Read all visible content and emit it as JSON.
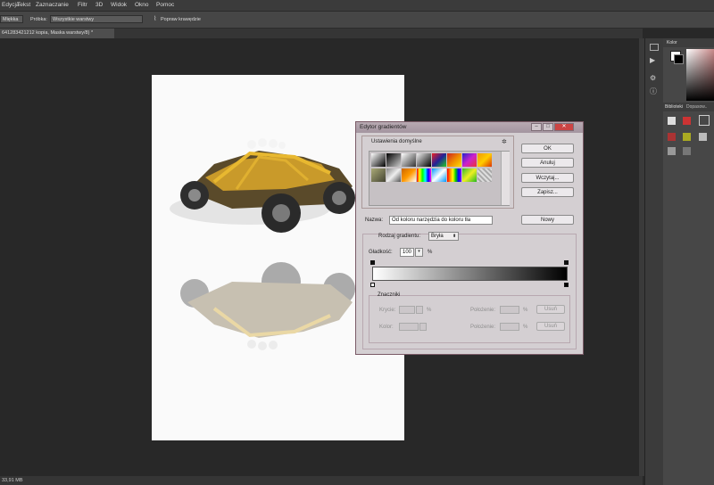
{
  "menubar": {
    "items": [
      "Edycja",
      "Tekst",
      "Zaznaczanie",
      "Filtr",
      "3D",
      "Widok",
      "Okno",
      "Pomoc"
    ]
  },
  "options": {
    "tool_select": "Miękka",
    "sample_label": "Próbka:",
    "sample_value": "Wszystkie warstwy",
    "enhance_label": "Popraw krawędzie"
  },
  "document": {
    "tab_title": "641283421212 kopia, Maska warstwy/8) *",
    "status_text": "33,91 MB"
  },
  "panels": {
    "color_tab": "Kolor",
    "library_tab": "Biblioteki",
    "adjust_tab": "Dopasow.."
  },
  "dialog": {
    "title": "Edytor gradientów",
    "presets_label": "Ustawienia domyślne",
    "ok": "OK",
    "cancel": "Anuluj",
    "load": "Wczytaj...",
    "save": "Zapisz...",
    "name_label": "Nazwa:",
    "name_value": "Od koloru narzędzia do koloru tła",
    "new_button": "Nowy",
    "type_label": "Rodzaj gradientu:",
    "type_value": "Bryła",
    "smooth_label": "Gładkość:",
    "smooth_value": "100",
    "smooth_unit": "%",
    "stops_label": "Znaczniki",
    "opacity_label": "Krycie:",
    "opacity_unit": "%",
    "location_label": "Położenie:",
    "location_unit": "%",
    "delete_button": "Usuń",
    "color_label": "Kolor:",
    "location2_label": "Położenie:",
    "location2_unit": "%",
    "delete2_button": "Usuń"
  }
}
